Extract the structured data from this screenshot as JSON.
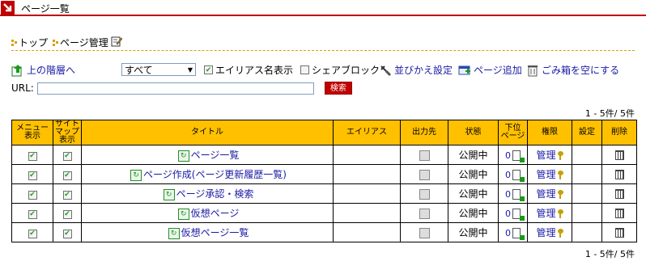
{
  "header": {
    "title": "ページ一覧"
  },
  "breadcrumb": {
    "items": [
      {
        "label": "トップ"
      },
      {
        "label": "ページ管理"
      }
    ]
  },
  "toolbar": {
    "up_label": "上の階層へ",
    "filter_value": "すべて",
    "alias_label": "エイリアス名表示",
    "share_label": "シェアブロック",
    "sort_label": "並びかえ設定",
    "add_label": "ページ追加",
    "trash_label": "ごみ箱を空にする"
  },
  "url": {
    "label": "URL:",
    "value": "",
    "search_label": "検索"
  },
  "count": "1 - 5件/ 5件",
  "columns": {
    "menu": [
      "メニュー",
      "表示"
    ],
    "sitemap": [
      "サイト",
      "マップ",
      "表示"
    ],
    "title": "タイトル",
    "alias": "エイリアス",
    "output": "出力先",
    "status": "状態",
    "sub": [
      "下位",
      "ページ"
    ],
    "perm": "権限",
    "setting": "設定",
    "delete": "削除"
  },
  "rows": [
    {
      "title": "ページ一覧",
      "alias": "",
      "status": "公開中",
      "sub_count": "0",
      "perm": "管理"
    },
    {
      "title": "ページ作成(ページ更新履歴一覧)",
      "alias": "",
      "status": "公開中",
      "sub_count": "0",
      "perm": "管理"
    },
    {
      "title": "ページ承認・検索",
      "alias": "",
      "status": "公開中",
      "sub_count": "0",
      "perm": "管理"
    },
    {
      "title": "仮想ページ",
      "alias": "",
      "status": "公開中",
      "sub_count": "0",
      "perm": "管理"
    },
    {
      "title": "仮想ページ一覧",
      "alias": "",
      "status": "公開中",
      "sub_count": "0",
      "perm": "管理"
    }
  ],
  "colors": {
    "accent": "#c00000",
    "header_bg": "#ffc000",
    "link": "#1a1aa6"
  }
}
